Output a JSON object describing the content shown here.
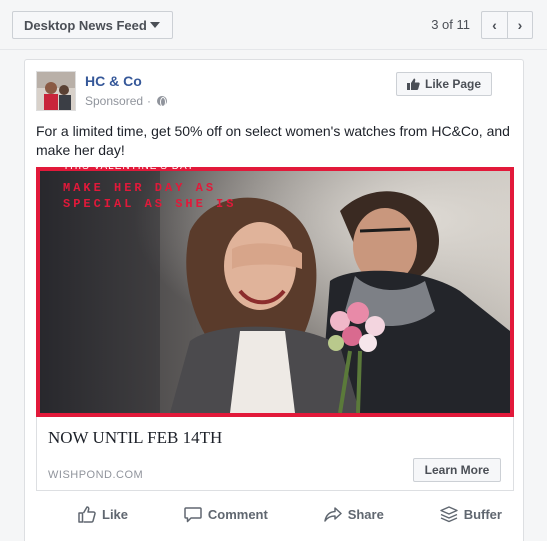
{
  "toolbar": {
    "placement_label": "Desktop News Feed",
    "pager_text": "3 of 11",
    "prev_symbol": "‹",
    "next_symbol": "›"
  },
  "post": {
    "page_name": "HC & Co",
    "sponsored_label": "Sponsored",
    "sponsored_sep": "·",
    "like_page_label": "Like Page",
    "text": "For a limited time, get 50% off on select women's watches from HC&Co, and make her day!",
    "image": {
      "kicker": "THIS VALENTINE'S DAY",
      "headline": "MAKE HER DAY AS SPECIAL AS SHE IS",
      "border_color": "#e2193a"
    },
    "link": {
      "title": "NOW UNTIL FEB 14TH",
      "domain": "WISHPOND.COM",
      "cta_label": "Learn More"
    },
    "actions": [
      {
        "label": "Like",
        "icon": "thumbs-up-icon"
      },
      {
        "label": "Comment",
        "icon": "comment-icon"
      },
      {
        "label": "Share",
        "icon": "share-icon"
      },
      {
        "label": "Buffer",
        "icon": "buffer-icon"
      }
    ]
  },
  "colors": {
    "link_blue": "#365899",
    "accent_red": "#e2193a",
    "muted_text": "#90949c"
  }
}
